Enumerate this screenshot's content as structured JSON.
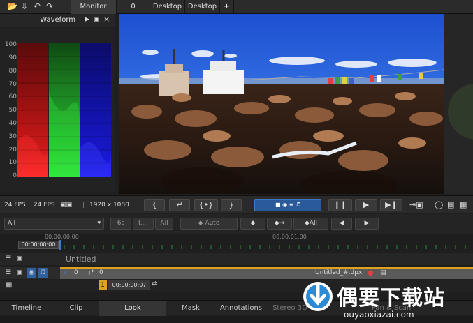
{
  "topbar": {
    "tabs": [
      "Monitor",
      "0",
      "Desktop",
      "Desktop"
    ],
    "add_icon": "+"
  },
  "waveform": {
    "title": "Waveform",
    "ticks": [
      "100",
      "90",
      "80",
      "70",
      "60",
      "50",
      "40",
      "30",
      "20",
      "10",
      "0"
    ]
  },
  "status": {
    "fps1": "24 FPS",
    "fps2": "24 FPS",
    "resolution": "1920 x 1080"
  },
  "controls": {
    "filter_value": "All",
    "btn_6s": "6s",
    "btn_i": "I...I",
    "btn_all": "All",
    "btn_auto": "Auto",
    "btn_key_all": "All"
  },
  "timeline": {
    "time_start": "00:00:00:00",
    "time_mark": "00:00:01:00",
    "current_time": "00:00:00:00"
  },
  "tracks": {
    "header_title": "Untitled",
    "track1_num": "0",
    "track1_val": "0",
    "track1_file": "Untitled_#.dpx",
    "clip_num": "1",
    "clip_time": "00:00:00:07"
  },
  "bottom_tabs": [
    "Timeline",
    "Clip",
    "Look",
    "Mask",
    "Annotations",
    "Stereo 3D",
    "Pan & Scan"
  ],
  "watermark": {
    "text_cn": "偶要下载站",
    "url": "ouyaoxiazai.com"
  },
  "colors": {
    "accent": "#3d7bc6",
    "orange": "#e0a020"
  }
}
